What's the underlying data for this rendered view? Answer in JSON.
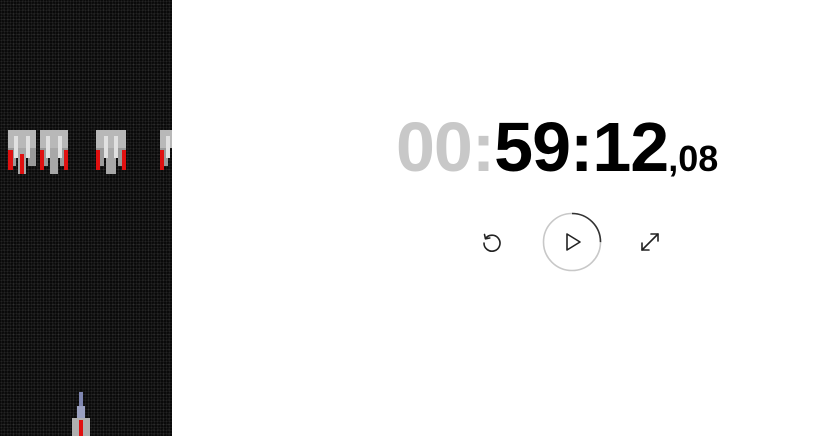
{
  "game": {
    "name": "space-invaders-preview",
    "enemy_icon": "invader-ship-icon",
    "player_icon": "player-ship-icon"
  },
  "stopwatch": {
    "hours": "00:",
    "main": "59:12",
    "hundredths": ",08",
    "progress_fraction": 0.25
  },
  "controls": {
    "reset_icon": "reset-icon",
    "play_icon": "play-icon",
    "fullscreen_icon": "fullscreen-icon"
  },
  "colors": {
    "dim_digits": "#c8c8c8",
    "active_digits": "#000000",
    "ring_track": "#c8c8c8",
    "ring_progress": "#333333",
    "enemy_red": "#e01010"
  }
}
